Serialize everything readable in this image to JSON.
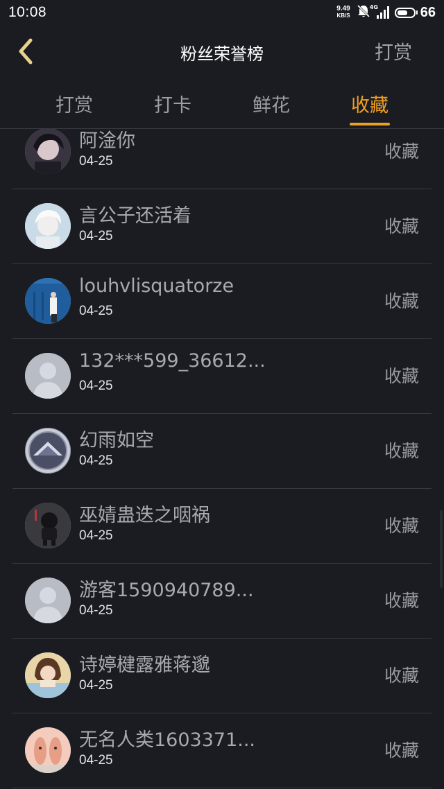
{
  "status_bar": {
    "time": "10:08",
    "net_speed": "9.49",
    "net_unit": "KB/S",
    "network_type": "4G",
    "battery": "66",
    "battery_level": 0.66
  },
  "header": {
    "title": "粉丝荣誉榜",
    "action_label": "打赏"
  },
  "tabs": [
    {
      "label": "打赏",
      "active": false
    },
    {
      "label": "打卡",
      "active": false
    },
    {
      "label": "鲜花",
      "active": false
    },
    {
      "label": "收藏",
      "active": true
    }
  ],
  "colors": {
    "accent": "#f0a020",
    "background": "#1b1c22",
    "divider": "#3a3b42"
  },
  "items": [
    {
      "name": "阿淦你",
      "date": "04-25",
      "action": "收藏",
      "avatar": "anime-boy-avatar"
    },
    {
      "name": "言公子还活着",
      "date": "04-25",
      "action": "收藏",
      "avatar": "anime-white-hair-avatar"
    },
    {
      "name": "louhvlisquatorze",
      "date": "04-25",
      "action": "收藏",
      "avatar": "photo-blue-container-avatar"
    },
    {
      "name": "132***599_36612...",
      "date": "04-25",
      "action": "收藏",
      "avatar": "default-avatar"
    },
    {
      "name": "幻雨如空",
      "date": "04-25",
      "action": "收藏",
      "avatar": "fan-pattern-avatar"
    },
    {
      "name": "巫婧蛊迭之咽祸",
      "date": "04-25",
      "action": "收藏",
      "avatar": "dark-toy-avatar"
    },
    {
      "name": "游客1590940789...",
      "date": "04-25",
      "action": "收藏",
      "avatar": "default-avatar"
    },
    {
      "name": "诗婷楗露雅蒋邈",
      "date": "04-25",
      "action": "收藏",
      "avatar": "girl-photo-avatar"
    },
    {
      "name": "无名人类1603371...",
      "date": "04-25",
      "action": "收藏",
      "avatar": "pink-rabbits-avatar"
    }
  ]
}
